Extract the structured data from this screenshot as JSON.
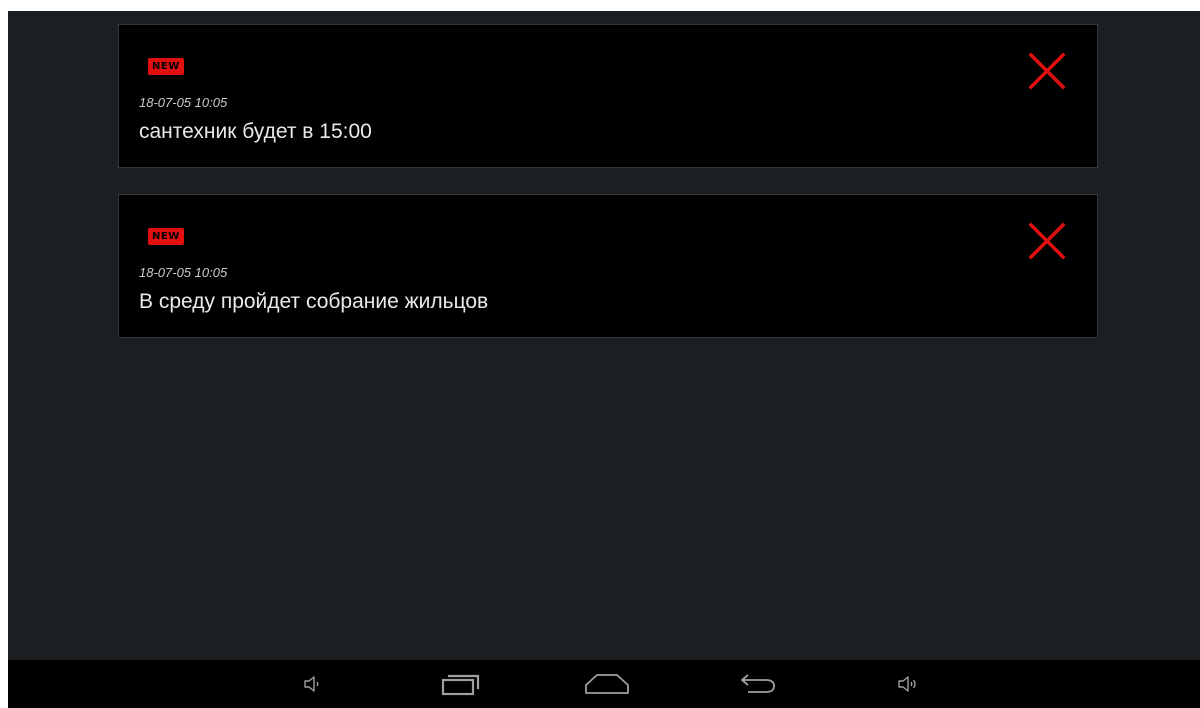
{
  "messages": [
    {
      "badge": "NEW",
      "timestamp": "18-07-05 10:05",
      "text": "сантехник будет в 15:00",
      "close_icon": "close-x-icon"
    },
    {
      "badge": "NEW",
      "timestamp": "18-07-05 10:05",
      "text": "В среду пройдет собрание жильцов",
      "close_icon": "close-x-icon"
    }
  ],
  "navbar": {
    "buttons": [
      {
        "icon": "volume-down-icon"
      },
      {
        "icon": "recent-apps-icon"
      },
      {
        "icon": "home-icon"
      },
      {
        "icon": "back-icon"
      },
      {
        "icon": "volume-up-icon"
      }
    ]
  },
  "colors": {
    "background": "#1b1f22",
    "card": "#000000",
    "card_border": "#31363a",
    "accent_red": "#e01010",
    "text": "#e8e9ea",
    "timestamp": "#c9cbcc",
    "nav_icon": "#9da0a3"
  }
}
